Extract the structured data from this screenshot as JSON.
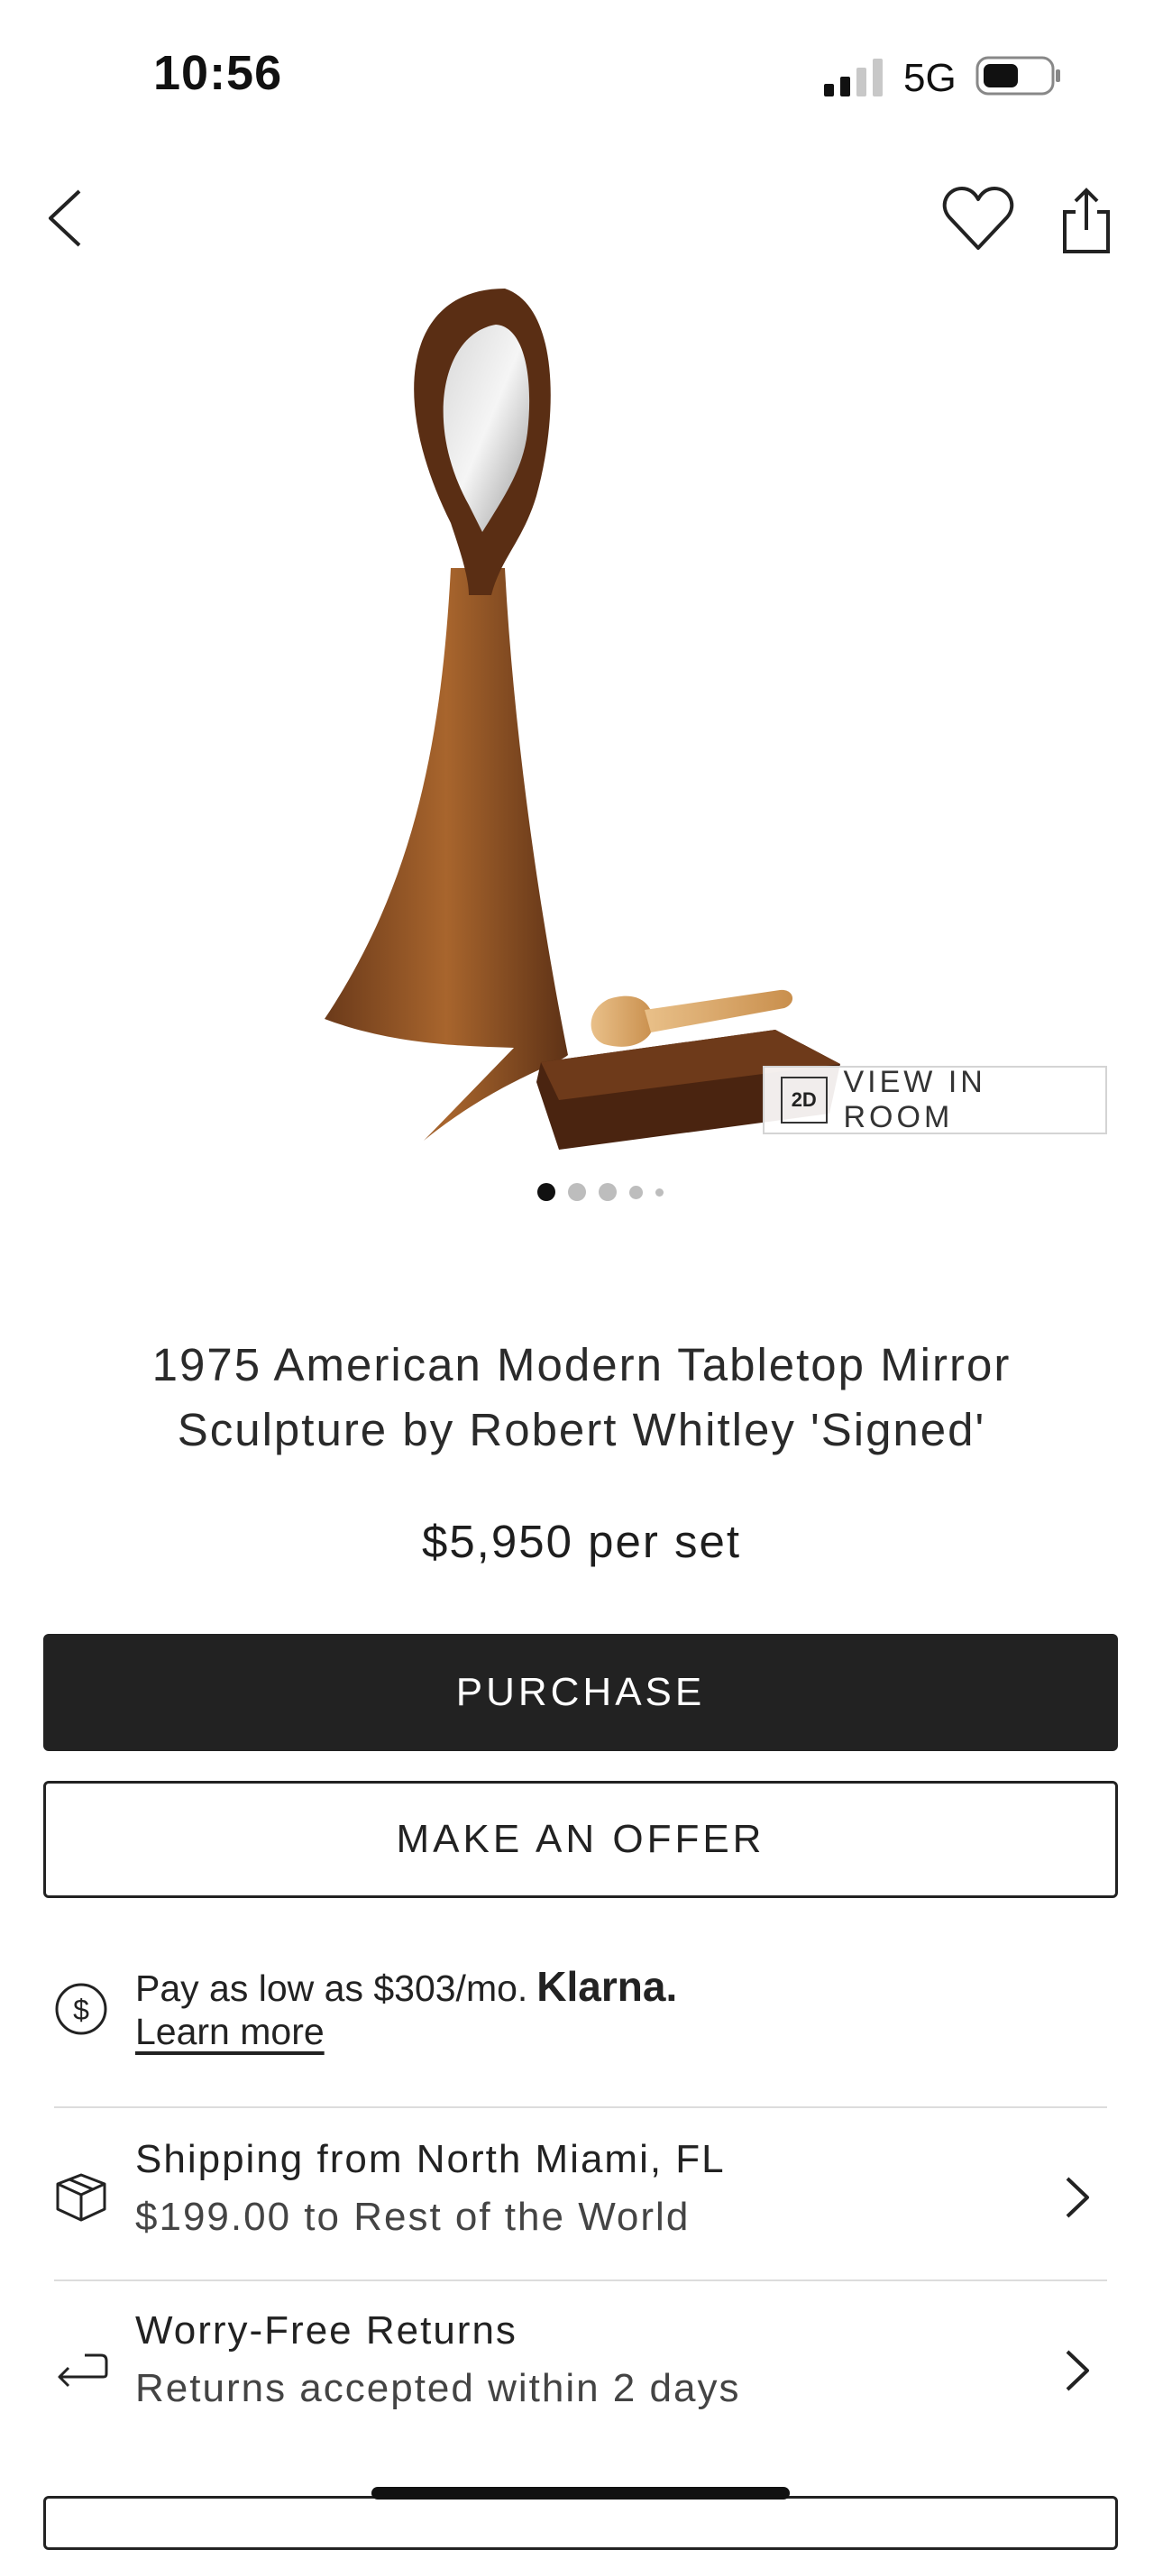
{
  "status_bar": {
    "time": "10:56",
    "network": "5G"
  },
  "nav": {
    "back_icon": "chevron-left-icon",
    "favorite_icon": "heart-icon",
    "share_icon": "share-icon"
  },
  "hero": {
    "view_in_room": {
      "badge": "2D",
      "label": "VIEW IN ROOM"
    },
    "carousel": {
      "total": 5,
      "active": 1
    }
  },
  "product": {
    "title_line1": "1975 American Modern Tabletop Mirror",
    "title_line2": "Sculpture by Robert Whitley 'Signed'",
    "price": "$5,950 per set"
  },
  "actions": {
    "purchase": "PURCHASE",
    "offer": "MAKE AN OFFER"
  },
  "financing": {
    "text": "Pay as low as $303/mo.",
    "brand": "Klarna.",
    "link": "Learn more",
    "icon": "dollar-circle-icon"
  },
  "shipping": {
    "title": "Shipping from North Miami, FL",
    "subtitle": "$199.00 to Rest of the World",
    "icon": "box-icon"
  },
  "returns": {
    "title": "Worry-Free Returns",
    "subtitle": "Returns accepted within 2 days",
    "icon": "return-arrow-icon"
  },
  "colors": {
    "primary_button": "#222222",
    "text": "#222222",
    "divider": "#dcdcdc"
  }
}
